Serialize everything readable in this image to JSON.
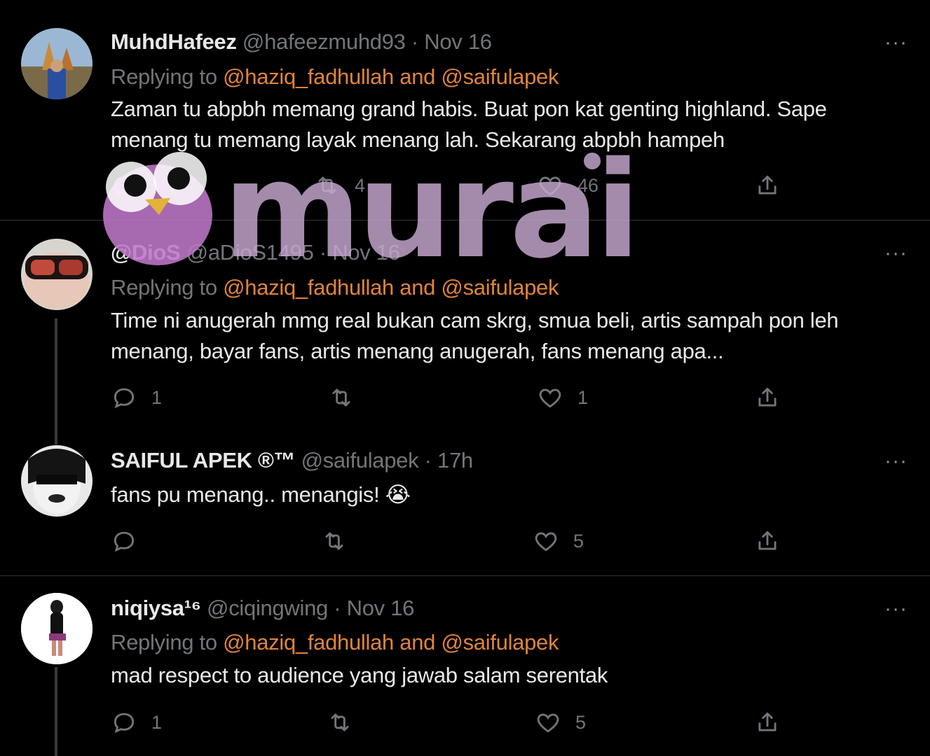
{
  "tweets": [
    {
      "name": "MuhdHafeez",
      "handle": "@hafeezmuhd93",
      "dot": "·",
      "time": "Nov 16",
      "reply_prefix": "Replying to",
      "reply_mentions": "@haziq_fadhullah and @saifulapek",
      "body": "Zaman tu abpbh memang grand habis. Buat pon kat genting highland. Sape menang tu memang layak menang lah. Sekarang abpbh hampeh",
      "reply_count": "",
      "retweet_count": "4",
      "like_count": "46",
      "more": "···"
    },
    {
      "name": "@DioS",
      "handle": "@aDioS1495",
      "dot": "·",
      "time": "Nov 16",
      "reply_prefix": "Replying to",
      "reply_mentions": "@haziq_fadhullah and @saifulapek",
      "body": "Time ni anugerah mmg real bukan cam skrg, smua beli, artis sampah pon leh menang, bayar fans, artis menang anugerah, fans menang apa...",
      "reply_count": "1",
      "retweet_count": "",
      "like_count": "1",
      "more": "···"
    },
    {
      "name": "SAIFUL APEK ®™",
      "handle": "@saifulapek",
      "dot": "·",
      "time": "17h",
      "body": "fans pu menang.. menangis! 😭",
      "reply_count": "",
      "retweet_count": "",
      "like_count": "5",
      "more": "···"
    },
    {
      "name": "niqiysa¹⁶",
      "handle": "@ciqingwing",
      "dot": "·",
      "time": "Nov 16",
      "reply_prefix": "Replying to",
      "reply_mentions": "@haziq_fadhullah and @saifulapek",
      "body": "mad respect to audience yang jawab salam serentak",
      "reply_count": "1",
      "retweet_count": "",
      "like_count": "5",
      "more": "···"
    }
  ],
  "watermark": {
    "text": "murai"
  },
  "colors": {
    "mention": "#e0843a",
    "muted": "#71767b",
    "text": "#e7e9ea",
    "background": "#000000"
  }
}
